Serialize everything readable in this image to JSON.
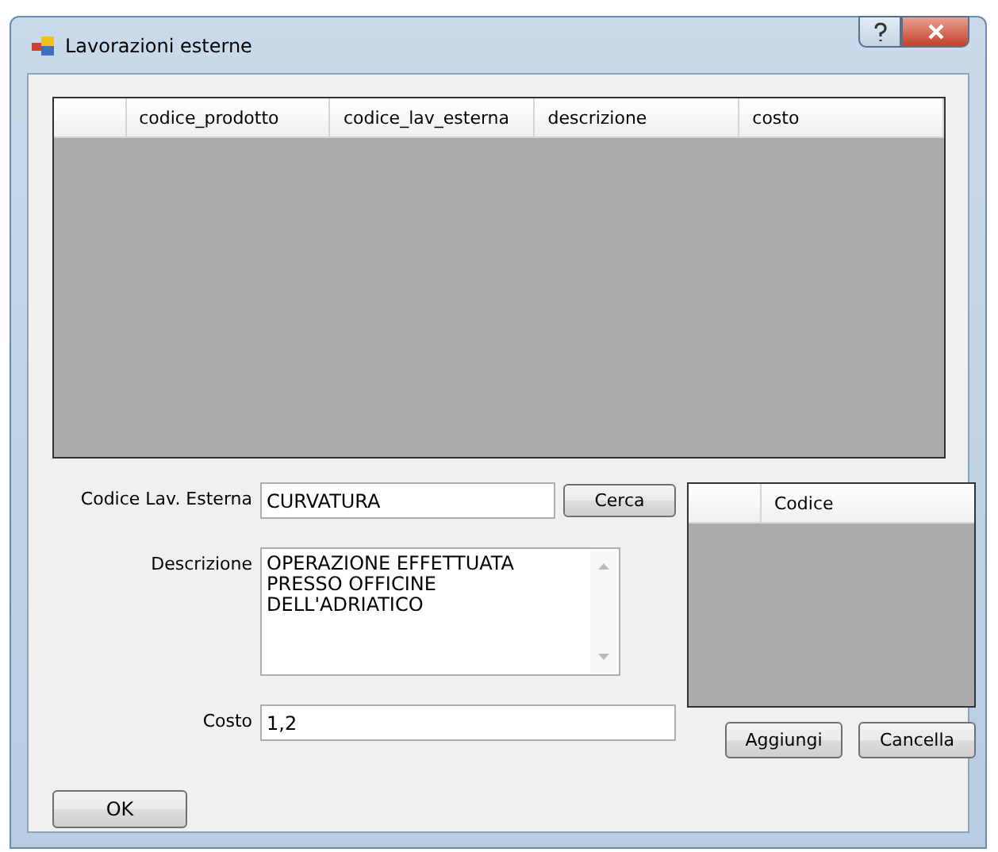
{
  "window": {
    "title": "Lavorazioni esterne"
  },
  "main_table": {
    "columns": [
      "codice_prodotto",
      "codice_lav_esterna",
      "descrizione",
      "costo"
    ]
  },
  "form": {
    "codice_label": "Codice Lav. Esterna",
    "codice_value": "CURVATURA",
    "search_button": "Cerca",
    "descrizione_label": "Descrizione",
    "descrizione_value": "OPERAZIONE EFFETTUATA PRESSO OFFICINE DELL'ADRIATICO",
    "costo_label": "Costo",
    "costo_value": "1,2"
  },
  "codes_table": {
    "columns": [
      "Codice"
    ]
  },
  "buttons": {
    "add": "Aggiungi",
    "delete": "Cancella",
    "ok": "OK"
  }
}
